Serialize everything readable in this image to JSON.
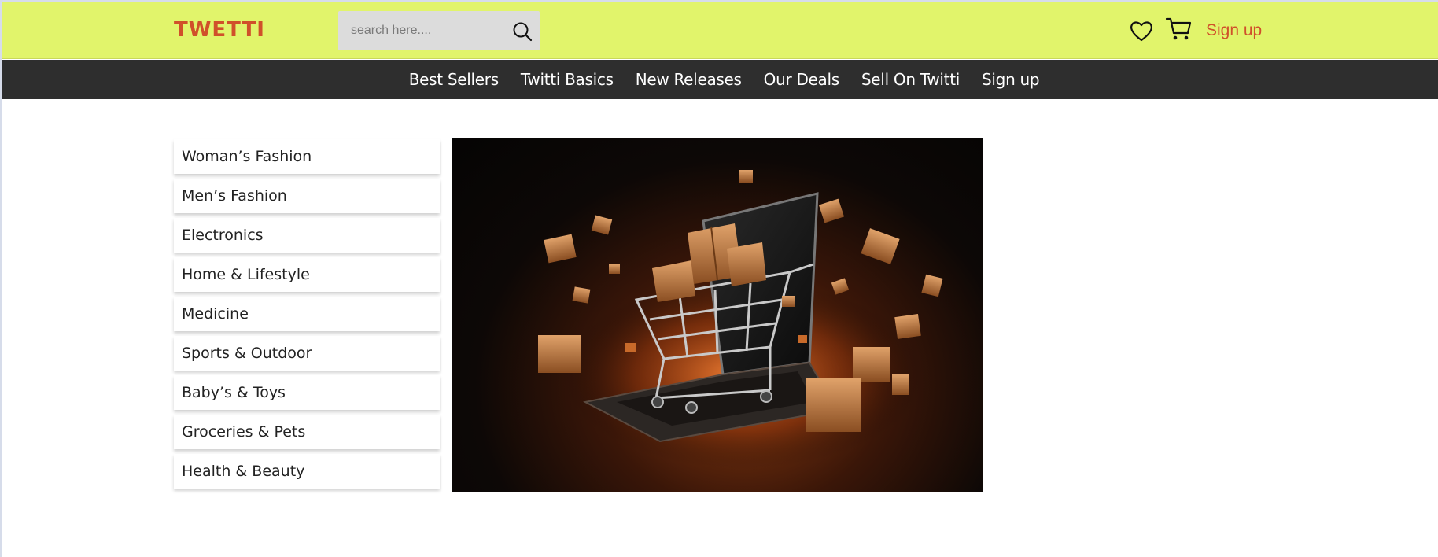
{
  "header": {
    "logo": "TWETTI",
    "search": {
      "placeholder": "search here....",
      "value": ""
    },
    "signup_label": "Sign up"
  },
  "nav": {
    "items": [
      {
        "label": "Best Sellers"
      },
      {
        "label": "Twitti Basics"
      },
      {
        "label": "New Releases"
      },
      {
        "label": "Our Deals"
      },
      {
        "label": "Sell On Twitti"
      },
      {
        "label": "Sign up"
      }
    ]
  },
  "categories": [
    {
      "label": "Woman’s Fashion"
    },
    {
      "label": "Men’s Fashion"
    },
    {
      "label": "Electronics"
    },
    {
      "label": "Home & Lifestyle"
    },
    {
      "label": "Medicine"
    },
    {
      "label": "Sports & Outdoor"
    },
    {
      "label": "Baby’s & Toys"
    },
    {
      "label": "Groceries & Pets"
    },
    {
      "label": "Health & Beauty"
    }
  ],
  "hero": {
    "image": "shopping-cart-on-laptop-with-flying-boxes"
  },
  "colors": {
    "topbar": "#e1f46b",
    "accent": "#d0502a",
    "navbar": "#2e2e2e"
  },
  "icons": [
    "search-icon",
    "heart-icon",
    "cart-icon"
  ]
}
